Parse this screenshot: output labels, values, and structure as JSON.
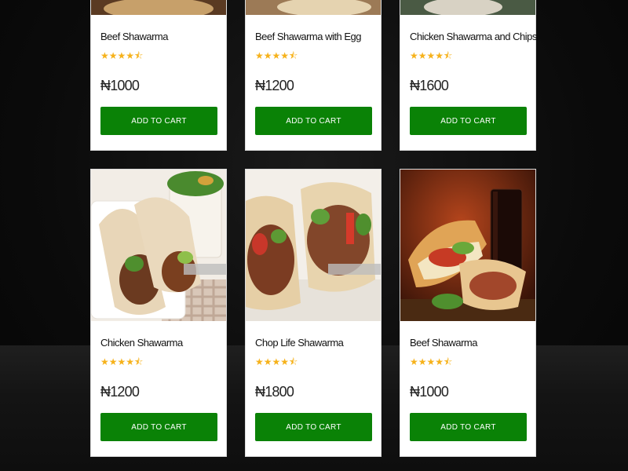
{
  "products": [
    {
      "name": "Beef Shawarma",
      "rating": 4.5,
      "price": "₦1000",
      "button": "ADD TO CART",
      "image": "beef-shawarma-photo"
    },
    {
      "name": "Beef Shawarma with Egg",
      "rating": 4.5,
      "price": "₦1200",
      "button": "ADD TO CART",
      "image": "beef-shawarma-egg-photo"
    },
    {
      "name": "Chicken Shawarma and Chips",
      "rating": 4.5,
      "price": "₦1600",
      "button": "ADD TO CART",
      "image": "chicken-shawarma-chips-photo"
    },
    {
      "name": "Chicken Shawarma",
      "rating": 4.5,
      "price": "₦1200",
      "button": "ADD TO CART",
      "image": "chicken-shawarma-photo"
    },
    {
      "name": "Chop Life Shawarma",
      "rating": 4.5,
      "price": "₦1800",
      "button": "ADD TO CART",
      "image": "chop-life-shawarma-photo"
    },
    {
      "name": "Beef Shawarma",
      "rating": 4.5,
      "price": "₦1000",
      "button": "ADD TO CART",
      "image": "beef-shawarma-cola-photo"
    }
  ],
  "stars_text": "★★★★⯪",
  "colors": {
    "button": "#0a8206",
    "star": "#f6b21b",
    "page_background": "#0c0c0c"
  }
}
